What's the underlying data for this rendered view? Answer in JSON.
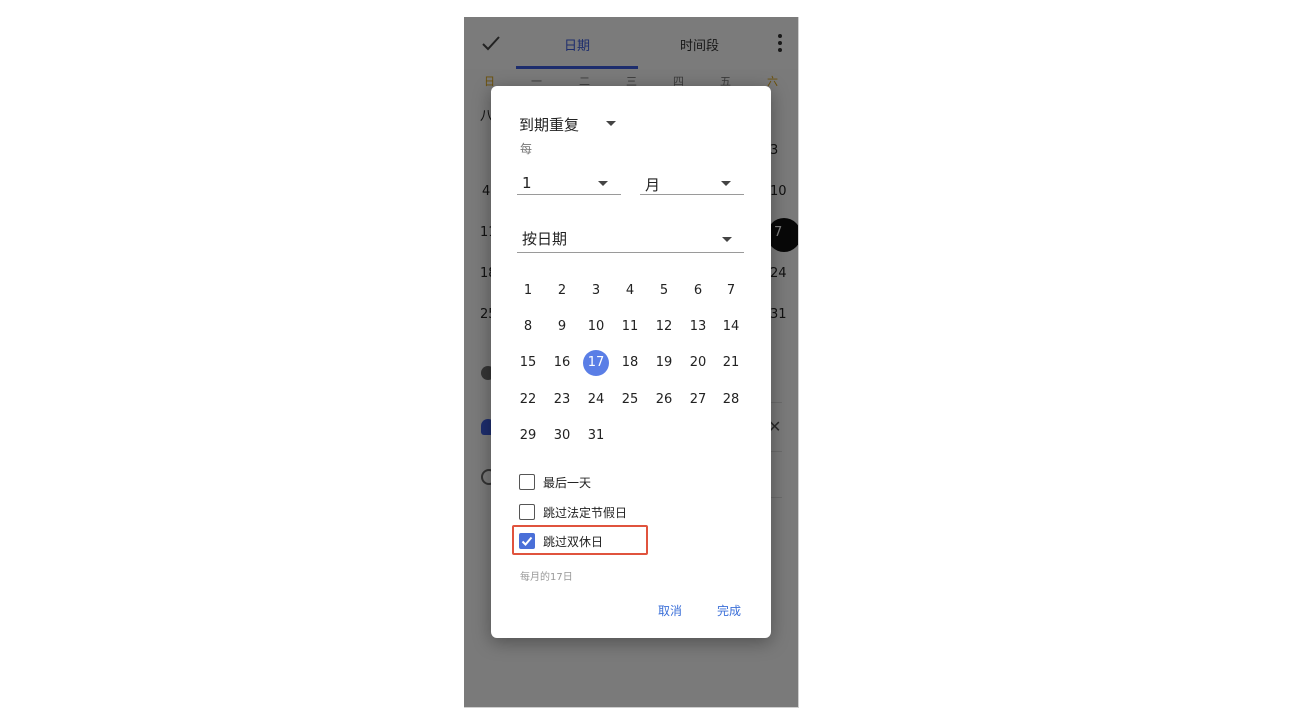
{
  "topbar": {
    "tabs": [
      {
        "label": "日期"
      },
      {
        "label": "时间段"
      }
    ]
  },
  "background": {
    "weekdays": [
      "日",
      "一",
      "二",
      "三",
      "四",
      "五",
      "六"
    ],
    "left_cells": [
      "八",
      "4",
      "11",
      "18",
      "25"
    ],
    "right_cells": [
      "3",
      "10",
      "7",
      "24",
      "31"
    ]
  },
  "dialog": {
    "title": "到期重复",
    "subtitle": "每",
    "interval_value": "1",
    "interval_unit": "月",
    "mode": "按日期",
    "days": [
      "1",
      "2",
      "3",
      "4",
      "5",
      "6",
      "7",
      "8",
      "9",
      "10",
      "11",
      "12",
      "13",
      "14",
      "15",
      "16",
      "17",
      "18",
      "19",
      "20",
      "21",
      "22",
      "23",
      "24",
      "25",
      "26",
      "27",
      "28",
      "29",
      "30",
      "31"
    ],
    "selected_day": "17",
    "options": [
      {
        "label": "最后一天",
        "checked": false
      },
      {
        "label": "跳过法定节假日",
        "checked": false
      },
      {
        "label": "跳过双休日",
        "checked": true
      }
    ],
    "summary": "每月的17日",
    "cancel_label": "取消",
    "done_label": "完成"
  },
  "colors": {
    "accent": "#3b5bdb",
    "selected_day": "#5a7ee6",
    "highlight_border": "#e0533d"
  }
}
